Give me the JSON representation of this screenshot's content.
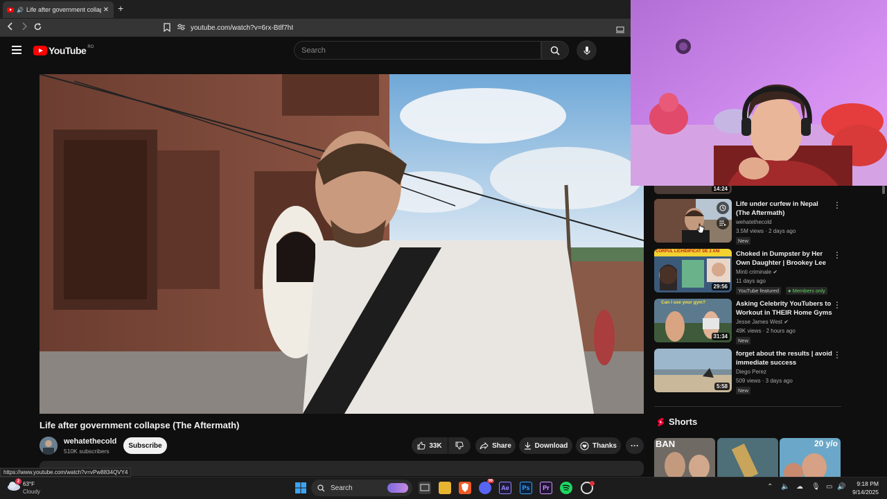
{
  "browser": {
    "tab_title": "Life after government collaps",
    "url": "youtube.com/watch?v=6rx-Btlf7hI",
    "status_url": "https://www.youtube.com/watch?v=vPw8834QVY4"
  },
  "youtube": {
    "logo_text": "YouTube",
    "country_code": "RO",
    "search_placeholder": "Search"
  },
  "video": {
    "title": "Life after government collapse (The Aftermath)",
    "channel": "wehatethecold",
    "subscribers": "510K subscribers",
    "subscribe_label": "Subscribe",
    "likes": "33K",
    "share_label": "Share",
    "download_label": "Download",
    "thanks_label": "Thanks"
  },
  "sidebar": {
    "partial_duration": "14:24",
    "recommendations": [
      {
        "title": "Life under curfew in Nepal (The Aftermath)",
        "channel": "wehatethecold",
        "meta": "3.5M views · 2 days ago",
        "badge": "New",
        "duration": ""
      },
      {
        "title": "Choked in Dumpster by Her Own Daughter | Brookey Lee ...",
        "channel": "Minti criminale",
        "meta": "11 days ago",
        "badge": "YouTube featured",
        "badge2": "Members only",
        "duration": "29:56",
        "thumb_text": "CORPUL LICHIDIFICAT DE 2 ANI"
      },
      {
        "title": "Asking Celebrity YouTubers to Workout in THEIR Home Gyms",
        "channel": "Jesse James West",
        "meta": "49K views · 2 hours ago",
        "badge": "New",
        "duration": "31:34",
        "thumb_text": "Can I use your gym?"
      },
      {
        "title": "forget about the results | avoid immediate success",
        "channel": "Diego Perez",
        "meta": "509 views · 3 days ago",
        "badge": "New",
        "duration": "5:58"
      }
    ],
    "shorts_label": "Shorts",
    "shorts_texts": [
      "BAN",
      "",
      "20 y/o"
    ]
  },
  "taskbar": {
    "temperature": "63°F",
    "weather": "Cloudy",
    "weather_badge": "2",
    "search_label": "Search",
    "time": "9:18 PM",
    "date": "9/14/2025",
    "discord_badge": "99"
  }
}
